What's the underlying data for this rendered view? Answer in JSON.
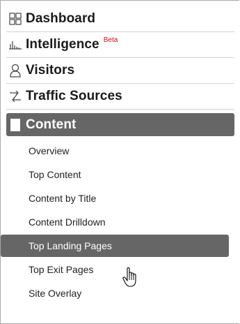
{
  "nav": {
    "main_items": [
      {
        "label": "Dashboard",
        "icon": "dashboard-grid-icon"
      },
      {
        "label": "Intelligence",
        "icon": "intelligence-chart-icon",
        "badge": "Beta"
      },
      {
        "label": "Visitors",
        "icon": "visitors-person-icon"
      },
      {
        "label": "Traffic Sources",
        "icon": "traffic-arrows-icon"
      },
      {
        "label": "Content",
        "icon": "content-square-icon"
      }
    ],
    "content_sub_items": [
      {
        "label": "Overview"
      },
      {
        "label": "Top Content"
      },
      {
        "label": "Content by Title"
      },
      {
        "label": "Content Drilldown"
      },
      {
        "label": "Top Landing Pages"
      },
      {
        "label": "Top Exit Pages"
      },
      {
        "label": "Site Overlay"
      }
    ]
  },
  "colors": {
    "active_bg": "#666666",
    "beta_text": "#d01010",
    "divider": "#d3d3d3"
  }
}
